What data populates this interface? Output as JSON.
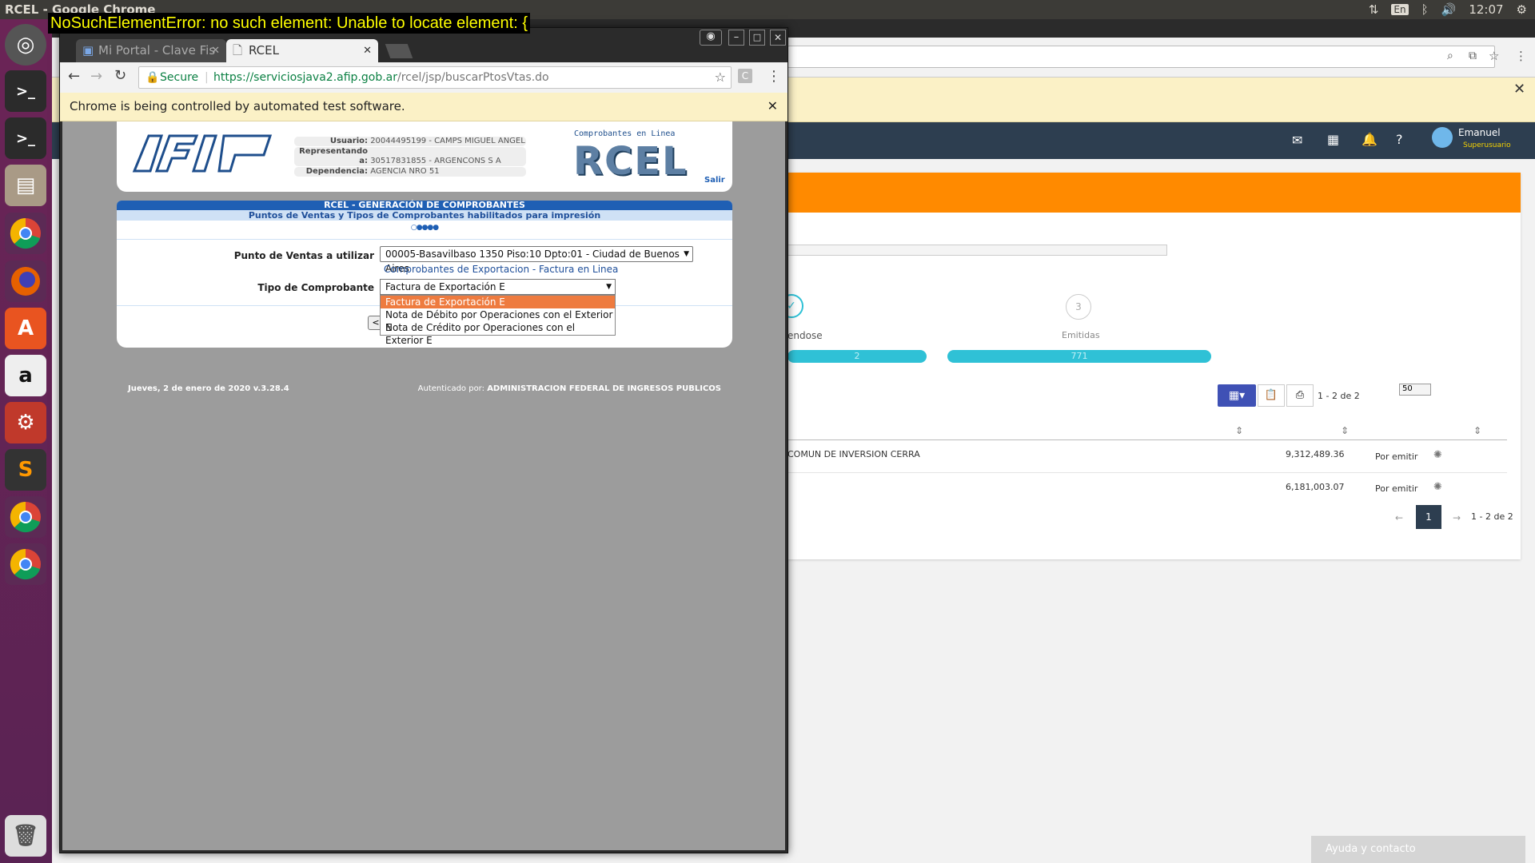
{
  "os": {
    "window_title": "RCEL - Google Chrome",
    "lang": "En",
    "clock": "12:07"
  },
  "error_overlay": "NoSuchElementError: no such element: Unable to locate element: {",
  "browser": {
    "tabs": [
      {
        "label": "Mi Portal - Clave Fis"
      },
      {
        "label": "RCEL"
      }
    ],
    "secure_label": "Secure",
    "url_domain": "https://serviciosjava2.afip.gob.ar",
    "url_path": "/rcel/jsp/buscarPtosVtas.do",
    "automation_notice": "Chrome is being controlled by automated test software."
  },
  "afip": {
    "logo": "AFIP",
    "usuario_label": "Usuario:",
    "usuario_value": "20044495199 - CAMPS MIGUEL ANGEL",
    "representando_label": "Representando a:",
    "representando_value": "30517831855 - ARGENCONS S A",
    "dependencia_label": "Dependencia:",
    "dependencia_value": "AGENCIA NRO 51",
    "rcel_caption": "Comprobantes en Linea",
    "rcel_logo": "RCEL",
    "salir": "Salir"
  },
  "form": {
    "title": "RCEL - GENERACIÓN DE COMPROBANTES",
    "subtitle": "Puntos de Ventas y Tipos de Comprobantes habilitados para impresión",
    "steps": "○●●●●",
    "punto_label": "Punto de Ventas a utilizar",
    "punto_value": "00005-Basavilbaso 1350 Piso:10 Dpto:01 - Ciudad de Buenos Aires",
    "punto_note": "Comprobantes de Exportacion - Factura en Linea",
    "tipo_label": "Tipo de Comprobante",
    "tipo_value": "Factura de Exportación E",
    "tipo_options": [
      "Factura de Exportación E",
      "Nota de Débito por Operaciones con el Exterior E",
      "Nota de Crédito por Operaciones con el Exterior E"
    ],
    "back_button": "<"
  },
  "footer": {
    "date": "Jueves, 2 de enero de 2020 v.3.28.4",
    "auth_prefix": "Autenticado por:",
    "auth_value": "ADMINISTRACION FEDERAL DE INGRESOS PUBLICOS"
  },
  "background_app": {
    "user_name": "Emanuel",
    "user_role": "Superusuario",
    "step3_number": "3",
    "step2_label": "endose",
    "step3_label": "Emitidas",
    "bar1_value": "2",
    "bar2_value": "771",
    "per_page": "50",
    "range_top": "1 - 2 de 2",
    "rows": [
      {
        "name": "COMUN DE INVERSION CERRA",
        "amount": "9,312,489.36",
        "status": "Por emitir"
      },
      {
        "name": "",
        "amount": "6,181,003.07",
        "status": "Por emitir"
      }
    ],
    "page": "1",
    "range_bottom": "1 - 2 de 2",
    "help": "Ayuda y contacto"
  }
}
